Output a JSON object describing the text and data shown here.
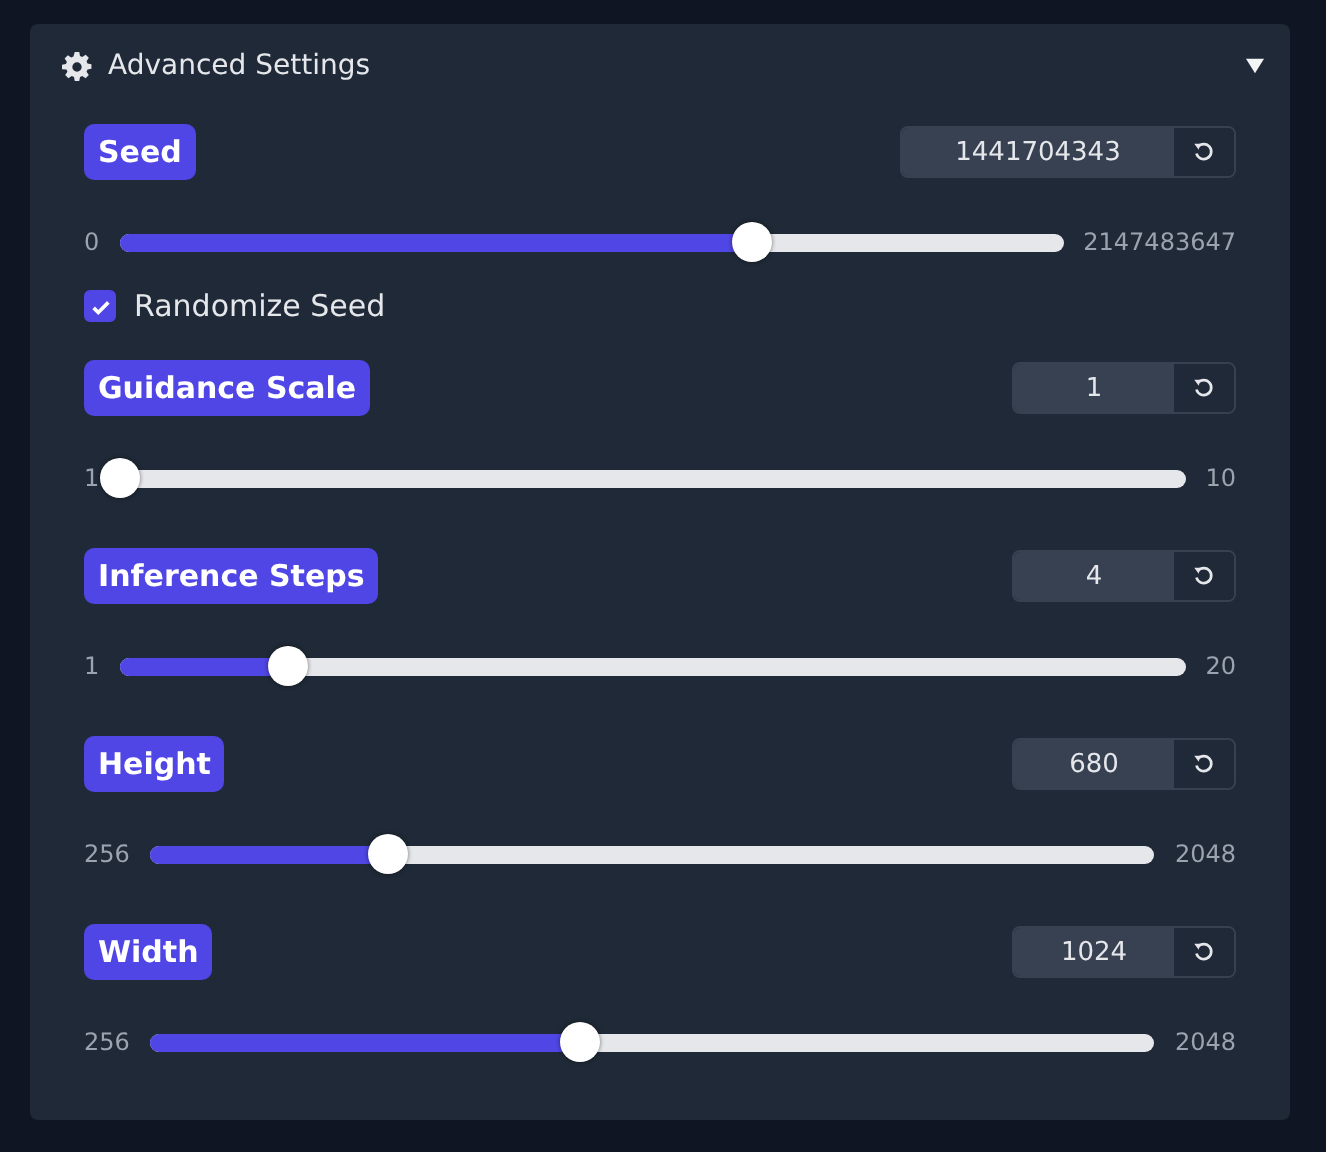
{
  "panel": {
    "title": "Advanced Settings",
    "expanded": true
  },
  "settings": [
    {
      "kind": "slider",
      "label": "Seed",
      "value": "1441704343",
      "min": "0",
      "max": "2147483647",
      "level": 0.671
    },
    {
      "kind": "checkbox",
      "label": "Randomize Seed",
      "checked": true
    },
    {
      "kind": "slider",
      "label": "Guidance Scale",
      "value": "1",
      "min": "1",
      "max": "10",
      "level": 0
    },
    {
      "kind": "slider",
      "label": "Inference Steps",
      "value": "4",
      "min": "1",
      "max": "20",
      "level": 0.158
    },
    {
      "kind": "slider",
      "label": "Height",
      "value": "680",
      "min": "256",
      "max": "2048",
      "level": 0.237
    },
    {
      "kind": "slider",
      "label": "Width",
      "value": "1024",
      "min": "256",
      "max": "2048",
      "level": 0.429
    }
  ]
}
